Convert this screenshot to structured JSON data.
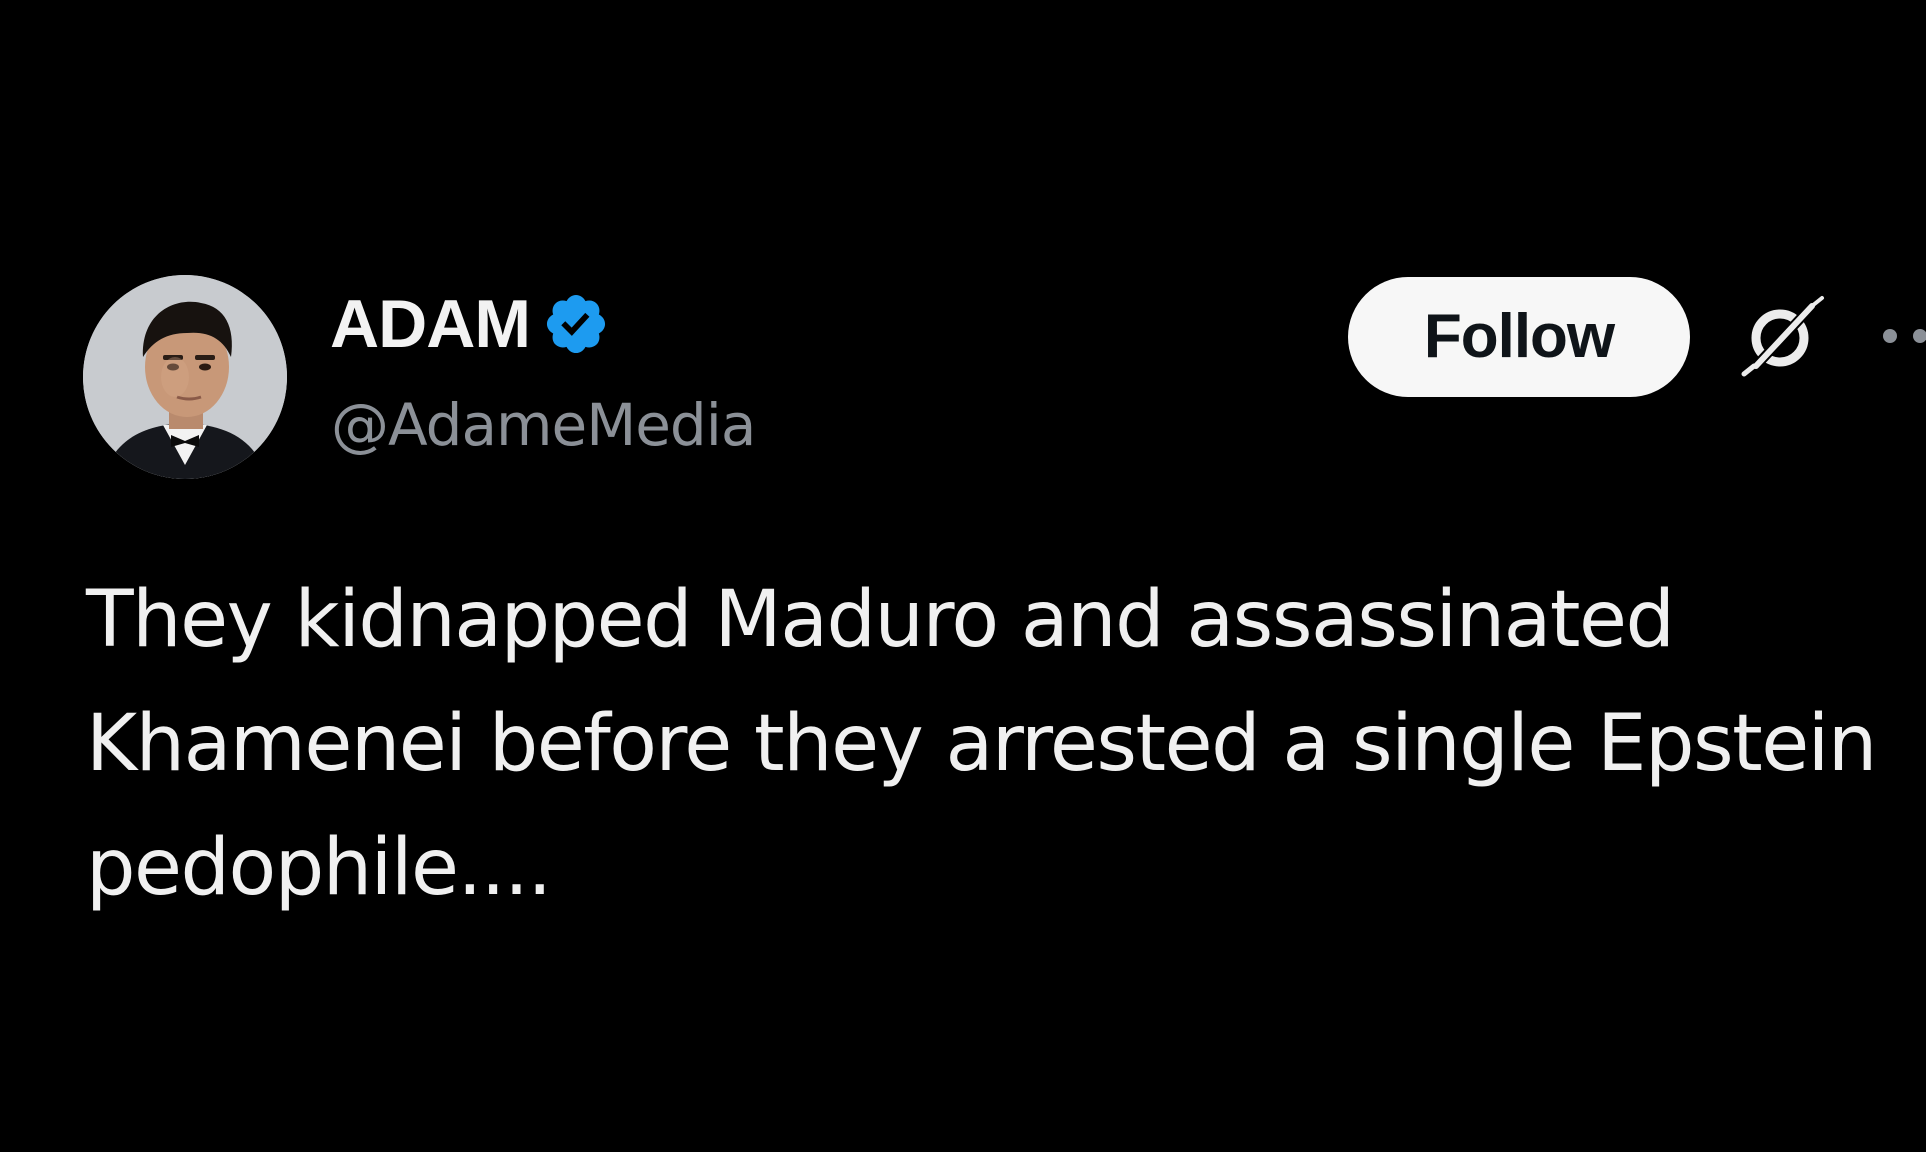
{
  "author": {
    "display_name": "ADAM",
    "handle": "@AdameMedia",
    "verified": true,
    "verified_badge_color": "#1d9bf0",
    "avatar_icon": "profile-photo"
  },
  "actions": {
    "follow_label": "Follow",
    "grok_icon": "grok-icon",
    "more_icon": "more-options-icon"
  },
  "tweet": {
    "lines": [
      "They kidnapped Maduro and assassinated",
      "Khamenei before they arrested a single Epstein",
      "pedophile...."
    ]
  },
  "colors": {
    "background": "#000000",
    "text_primary": "#f0f0f0",
    "text_secondary": "#8b9097",
    "follow_button_bg": "#f7f7f7",
    "follow_button_text": "#0f1419"
  }
}
